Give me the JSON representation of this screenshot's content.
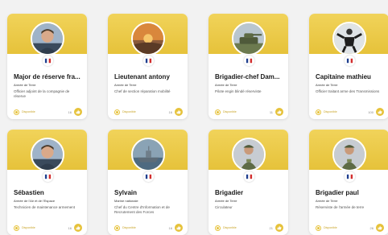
{
  "colors": {
    "accent": "#e6c23a",
    "page_background": "#f2f2f2",
    "card_background": "#ffffff"
  },
  "cards": [
    {
      "name": "Major de réserve fra...",
      "unit": "Armée de Terre",
      "role": "Officier adjoint de la compagnie de réserve",
      "status": "Disponible",
      "count": "16",
      "avatar_icon": "person-photo-icon"
    },
    {
      "name": "Lieutenant antony",
      "unit": "Armée de Terre",
      "role": "Chef de section réparation mobilité",
      "status": "Disponible",
      "count": "16",
      "avatar_icon": "sunset-photo-icon"
    },
    {
      "name": "Brigadier-chef Dam...",
      "unit": "Armée de Terre",
      "role": "Pilote engin blindé réserviste",
      "status": "Disponible",
      "count": "11",
      "avatar_icon": "tank-photo-icon"
    },
    {
      "name": "Capitaine mathieu",
      "unit": "Armée de Terre",
      "role": "Officier traitant arme des Transmissions",
      "status": "Disponible",
      "count": "100",
      "avatar_icon": "martial-arts-photo-icon"
    },
    {
      "name": "Sébastien",
      "unit": "Armée de l'Air et de l'Espace",
      "role": "Technicien de maintenance armement",
      "status": "Disponible",
      "count": "16",
      "avatar_icon": "person-photo-icon"
    },
    {
      "name": "Sylvain",
      "unit": "Marine nationale",
      "role": "Chef du Centre d'Information et de Recrutement des Forces",
      "status": "Disponible",
      "count": "16",
      "avatar_icon": "ship-photo-icon"
    },
    {
      "name": "Brigadier",
      "unit": "Armée de Terre",
      "role": "Circulateur",
      "status": "Disponible",
      "count": "21",
      "avatar_icon": "soldier-photo-icon"
    },
    {
      "name": "Brigadier paul",
      "unit": "Armée de Terre",
      "role": "Réserviste de l'armée de terre",
      "status": "Disponible",
      "count": "26",
      "avatar_icon": "soldier-photo-icon"
    }
  ]
}
